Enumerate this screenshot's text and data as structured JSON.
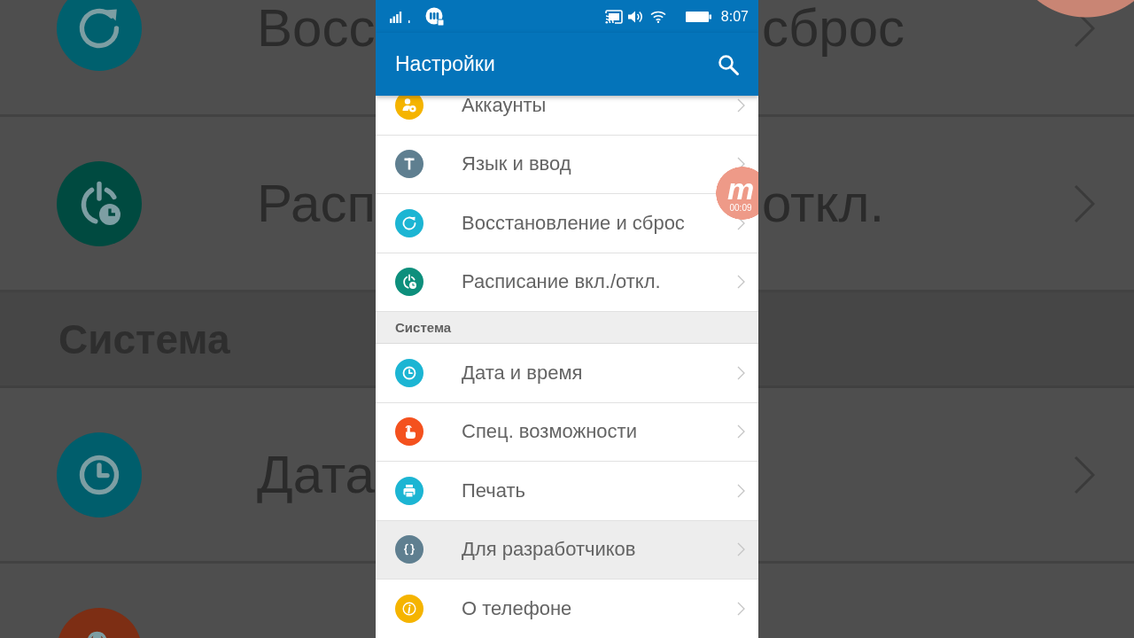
{
  "status_bar": {
    "time": "8:07"
  },
  "toolbar": {
    "title": "Настройки"
  },
  "groups": [
    {
      "items": [
        {
          "label": "Аккаунты",
          "color": "#f5b400",
          "highlighted": false
        },
        {
          "label": "Язык и ввод",
          "color": "#5f7f90",
          "highlighted": false
        },
        {
          "label": "Восстановление и сброс",
          "color": "#1cb5d3",
          "highlighted": false
        },
        {
          "label": "Расписание вкл./откл.",
          "color": "#0d8f7c",
          "highlighted": false
        }
      ]
    },
    {
      "header": "Система",
      "items": [
        {
          "label": "Дата и время",
          "color": "#1cb5d3",
          "highlighted": false
        },
        {
          "label": "Спец. возможности",
          "color": "#f4511e",
          "highlighted": false
        },
        {
          "label": "Печать",
          "color": "#1cb5d3",
          "highlighted": false
        },
        {
          "label": "Для разработчиков",
          "color": "#5f7f90",
          "highlighted": true
        },
        {
          "label": "О телефоне",
          "color": "#f5b400",
          "highlighted": false
        }
      ]
    }
  ],
  "recorder_bubble": {
    "logo": "m",
    "time": "00:09"
  },
  "backdrop": {
    "left": [
      {
        "kind": "item",
        "color": "#00606e",
        "label": "Восс"
      },
      {
        "kind": "item",
        "color": "#004a40",
        "label": "Расп"
      },
      {
        "kind": "header",
        "label": "Система"
      },
      {
        "kind": "item",
        "color": "#005e6c",
        "label": "Дата"
      },
      {
        "kind": "item",
        "color": "#7d2e14"
      }
    ],
    "right": [
      {
        "kind": "item",
        "label": "сброс",
        "chevron": true
      },
      {
        "kind": "item",
        "label": "откл.",
        "chevron": true
      },
      {
        "kind": "header"
      },
      {
        "kind": "item",
        "chevron": true
      },
      {
        "kind": "item"
      }
    ]
  }
}
